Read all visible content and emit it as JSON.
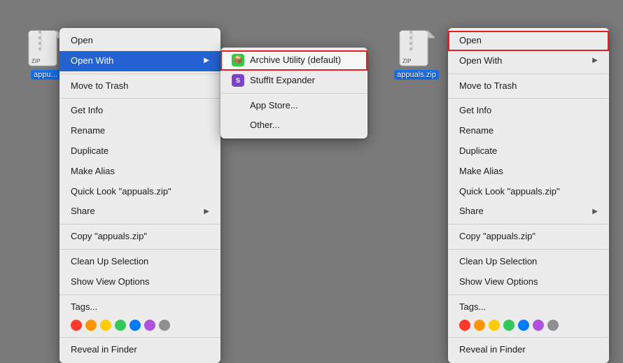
{
  "background_color": "#7a7a7a",
  "left": {
    "file_icon": {
      "label": "appu...",
      "full_name": "appuals.zip"
    },
    "context_menu": {
      "items": [
        {
          "id": "open",
          "label": "Open",
          "type": "item"
        },
        {
          "id": "open-with",
          "label": "Open With",
          "type": "item-arrow",
          "highlighted": true
        },
        {
          "id": "sep1",
          "type": "separator"
        },
        {
          "id": "move-to-trash",
          "label": "Move to Trash",
          "type": "item"
        },
        {
          "id": "sep2",
          "type": "separator"
        },
        {
          "id": "get-info",
          "label": "Get Info",
          "type": "item"
        },
        {
          "id": "rename",
          "label": "Rename",
          "type": "item"
        },
        {
          "id": "duplicate",
          "label": "Duplicate",
          "type": "item"
        },
        {
          "id": "make-alias",
          "label": "Make Alias",
          "type": "item"
        },
        {
          "id": "quick-look",
          "label": "Quick Look \"appuals.zip\"",
          "type": "item"
        },
        {
          "id": "share",
          "label": "Share",
          "type": "item-arrow"
        },
        {
          "id": "sep3",
          "type": "separator"
        },
        {
          "id": "copy",
          "label": "Copy \"appuals.zip\"",
          "type": "item"
        },
        {
          "id": "sep4",
          "type": "separator"
        },
        {
          "id": "clean-up",
          "label": "Clean Up Selection",
          "type": "item"
        },
        {
          "id": "show-view",
          "label": "Show View Options",
          "type": "item"
        },
        {
          "id": "sep5",
          "type": "separator"
        },
        {
          "id": "tags",
          "type": "tags"
        },
        {
          "id": "sep6",
          "type": "separator"
        },
        {
          "id": "reveal",
          "label": "Reveal in Finder",
          "type": "item"
        }
      ],
      "tags": [
        "#ff3b30",
        "#ff9500",
        "#ffcc00",
        "#34c759",
        "#007aff",
        "#af52de",
        "#8e8e93"
      ]
    },
    "submenu": {
      "items": [
        {
          "id": "archive-utility",
          "label": "Archive Utility (default)",
          "type": "app",
          "icon_color": "#2ecc40",
          "icon_text": "📦",
          "highlighted": true
        },
        {
          "id": "stuffit",
          "label": "StuffIt Expander",
          "type": "app",
          "icon_color": "#8e44ad",
          "icon_text": "S"
        },
        {
          "id": "sep1",
          "type": "separator"
        },
        {
          "id": "app-store",
          "label": "App Store...",
          "type": "item"
        },
        {
          "id": "other",
          "label": "Other...",
          "type": "item"
        }
      ]
    }
  },
  "right": {
    "file_icon": {
      "label": "appuals.zip",
      "full_name": "appuals.zip"
    },
    "context_menu": {
      "items": [
        {
          "id": "open",
          "label": "Open",
          "type": "item",
          "outlined": true
        },
        {
          "id": "open-with",
          "label": "Open With",
          "type": "item-arrow"
        },
        {
          "id": "sep1",
          "type": "separator"
        },
        {
          "id": "move-to-trash",
          "label": "Move to Trash",
          "type": "item"
        },
        {
          "id": "sep2",
          "type": "separator"
        },
        {
          "id": "get-info",
          "label": "Get Info",
          "type": "item"
        },
        {
          "id": "rename",
          "label": "Rename",
          "type": "item"
        },
        {
          "id": "duplicate",
          "label": "Duplicate",
          "type": "item"
        },
        {
          "id": "make-alias",
          "label": "Make Alias",
          "type": "item"
        },
        {
          "id": "quick-look",
          "label": "Quick Look \"appuals.zip\"",
          "type": "item"
        },
        {
          "id": "share",
          "label": "Share",
          "type": "item-arrow"
        },
        {
          "id": "sep3",
          "type": "separator"
        },
        {
          "id": "copy",
          "label": "Copy \"appuals.zip\"",
          "type": "item"
        },
        {
          "id": "sep4",
          "type": "separator"
        },
        {
          "id": "clean-up",
          "label": "Clean Up Selection",
          "type": "item"
        },
        {
          "id": "show-view",
          "label": "Show View Options",
          "type": "item"
        },
        {
          "id": "sep5",
          "type": "separator"
        },
        {
          "id": "tags",
          "type": "tags"
        },
        {
          "id": "sep6",
          "type": "separator"
        },
        {
          "id": "reveal",
          "label": "Reveal in Finder",
          "type": "item"
        }
      ],
      "tags": [
        "#ff3b30",
        "#ff9500",
        "#ffcc00",
        "#34c759",
        "#007aff",
        "#af52de",
        "#8e8e93"
      ]
    }
  }
}
